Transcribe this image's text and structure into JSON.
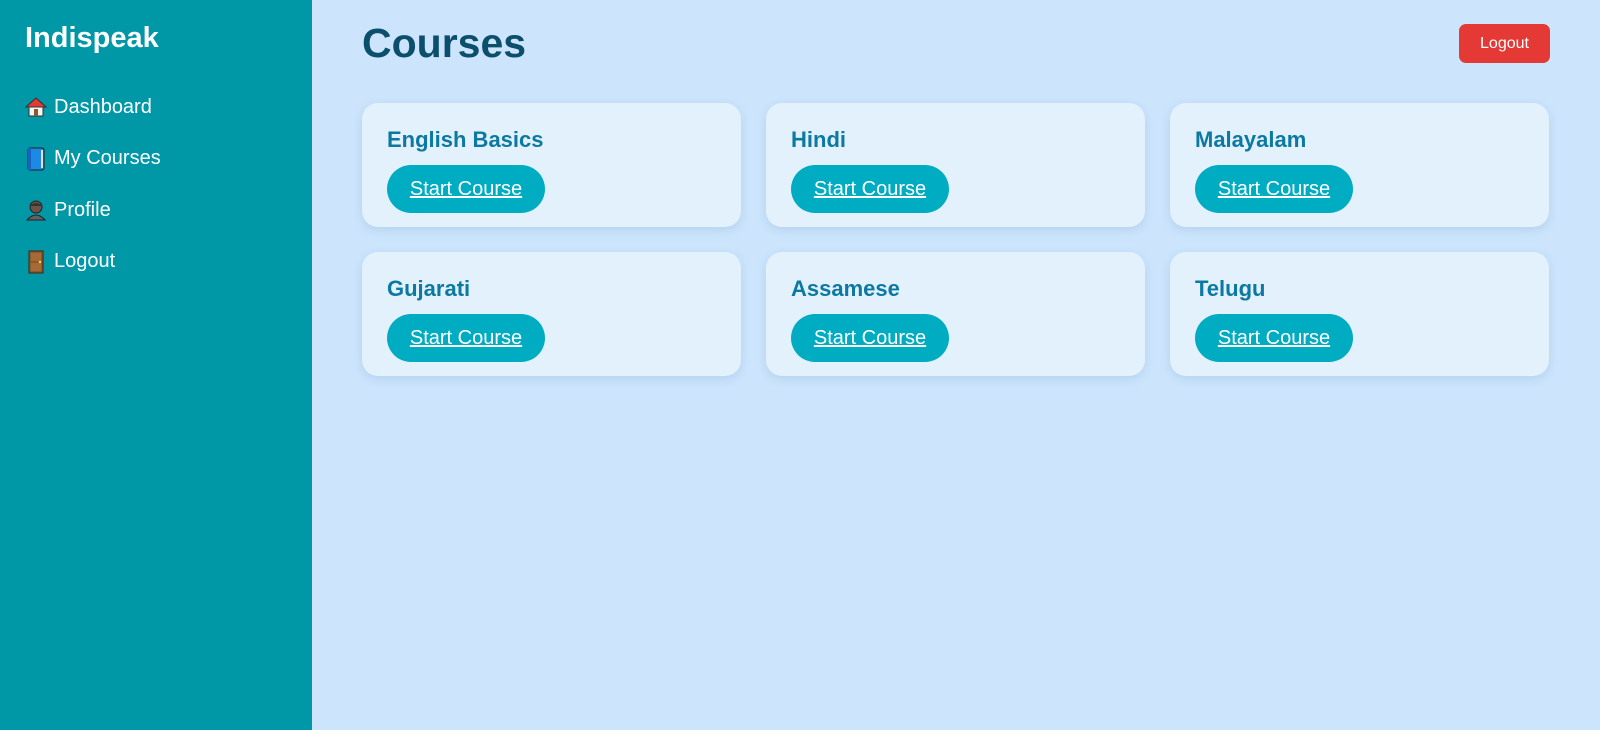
{
  "sidebar": {
    "brand": "Indispeak",
    "items": [
      {
        "label": "Dashboard",
        "icon": "house-icon"
      },
      {
        "label": "My Courses",
        "icon": "book-icon"
      },
      {
        "label": "Profile",
        "icon": "person-icon"
      },
      {
        "label": "Logout",
        "icon": "door-icon"
      }
    ]
  },
  "header": {
    "title": "Courses",
    "logout_label": "Logout"
  },
  "courses": [
    {
      "title": "English Basics",
      "button": "Start Course"
    },
    {
      "title": "Hindi",
      "button": "Start Course"
    },
    {
      "title": "Malayalam",
      "button": "Start Course"
    },
    {
      "title": "Gujarati",
      "button": "Start Course"
    },
    {
      "title": "Assamese",
      "button": "Start Course"
    },
    {
      "title": "Telugu",
      "button": "Start Course"
    }
  ],
  "colors": {
    "sidebar_bg": "#0097a7",
    "main_bg": "#cce5fd",
    "card_bg": "#e3f1fd",
    "title": "#0b4f6c",
    "card_title": "#0b79a1",
    "button": "#00acc1",
    "logout": "#e53935"
  }
}
